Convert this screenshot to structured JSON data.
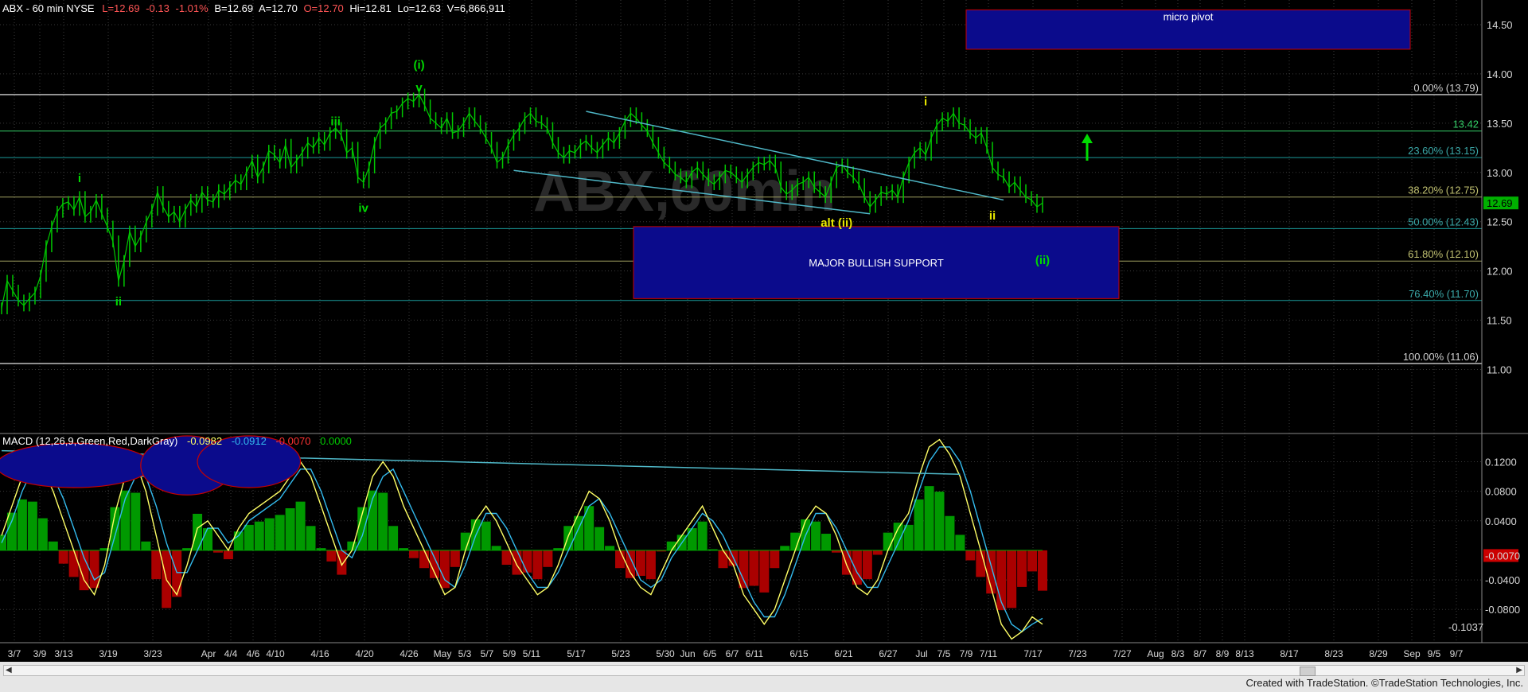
{
  "header": {
    "symbol": "ABX - 60 min  NYSE",
    "last": "L=12.69",
    "change": "-0.13",
    "change_pct": "-1.01%",
    "bid": "B=12.69",
    "ask": "A=12.70",
    "open": "O=12.70",
    "high": "Hi=12.81",
    "low": "Lo=12.63",
    "volume": "V=6,866,911"
  },
  "macd_header": {
    "name": "MACD (12,26,9,Green,Red,DarkGray)",
    "macd": "-0.0982",
    "signal": "-0.0912",
    "hist": "-0.0070",
    "zero": "0.0000"
  },
  "watermark": "ABX,60min",
  "footer_text": "Created with TradeStation. ©TradeStation Technologies, Inc.",
  "colors": {
    "price": "#00c800",
    "fib": "#1a9a9a",
    "wave_green": "#00d800",
    "wave_yellow": "#e6e600",
    "box": "#0b0b8c",
    "box_border": "#c80000",
    "macd_line": "#ffff66",
    "signal_line": "#33bbee",
    "hist_pos": "#009900",
    "hist_neg": "#aa0000"
  },
  "boxes": [
    {
      "label": "micro pivot",
      "x_start": "7/5",
      "x_end": "Sep 9/5",
      "y_low": 14.25,
      "y_high": 14.65
    },
    {
      "label": "MAJOR BULLISH SUPPORT",
      "x_start": "5/23",
      "x_end": "7/23",
      "y_low": 11.72,
      "y_high": 12.45
    }
  ],
  "wave_labels": [
    {
      "text": "(i)",
      "color": "green",
      "x_idx": 75,
      "y": 14.05
    },
    {
      "text": "v",
      "color": "green",
      "x_idx": 75,
      "y": 13.82
    },
    {
      "text": "iii",
      "color": "green",
      "x_idx": 60,
      "y": 13.48
    },
    {
      "text": "iv",
      "color": "green",
      "x_idx": 65,
      "y": 12.6
    },
    {
      "text": "i",
      "color": "green",
      "x_idx": 14,
      "y": 12.9
    },
    {
      "text": "ii",
      "color": "green",
      "x_idx": 21,
      "y": 11.65
    },
    {
      "text": "i",
      "color": "yellow",
      "x_idx": 166,
      "y": 13.68
    },
    {
      "text": "alt (ii)",
      "color": "yellow",
      "x_idx": 150,
      "y": 12.45
    },
    {
      "text": "ii",
      "color": "yellow",
      "x_idx": 178,
      "y": 12.52
    },
    {
      "text": "(ii)",
      "color": "green",
      "x_idx": 187,
      "y": 12.07
    }
  ],
  "chart_data": {
    "type": "line",
    "title": "ABX - 60 min  NYSE",
    "price_axis": {
      "ylim": [
        10.35,
        14.75
      ],
      "ticks": [
        "14.50",
        "14.00",
        "13.50",
        "13.00",
        "12.50",
        "12.00",
        "11.50",
        "11.00"
      ],
      "last_value": "12.69"
    },
    "macd_axis": {
      "ylim": [
        -0.125,
        0.155
      ],
      "ticks": [
        "0.1200",
        "0.0800",
        "0.0400",
        "-0.0400",
        "-0.0800"
      ],
      "current_hist": "-0.0070",
      "current_macd": "-0.1037"
    },
    "x_labels": [
      "3/7",
      "3/9",
      "3/13",
      "3/19",
      "3/23",
      "Apr",
      "4/4",
      "4/6",
      "4/10",
      "4/16",
      "4/20",
      "4/26",
      "May",
      "5/3",
      "5/7",
      "5/9",
      "5/11",
      "5/17",
      "5/23",
      "5/30",
      "Jun",
      "6/5",
      "6/7",
      "6/11",
      "6/15",
      "6/21",
      "6/27",
      "Jul",
      "7/5",
      "7/9",
      "7/11",
      "7/17",
      "7/23",
      "7/27",
      "Aug",
      "8/3",
      "8/7",
      "8/9",
      "8/13",
      "8/17",
      "8/23",
      "8/29",
      "Sep",
      "9/5",
      "9/7"
    ],
    "fib_levels": [
      {
        "label": "0.00% (13.79)",
        "value": 13.79
      },
      {
        "label": "13.42",
        "value": 13.42
      },
      {
        "label": "23.60% (13.15)",
        "value": 13.15
      },
      {
        "label": "38.20% (12.75)",
        "value": 12.75
      },
      {
        "label": "50.00% (12.43)",
        "value": 12.43
      },
      {
        "label": "61.80% (12.10)",
        "value": 12.1
      },
      {
        "label": "76.40% (11.70)",
        "value": 11.7
      },
      {
        "label": "100.00% (11.06)",
        "value": 11.06
      }
    ],
    "price_series": [
      11.62,
      11.9,
      11.8,
      11.7,
      11.65,
      11.72,
      11.78,
      11.95,
      12.25,
      12.45,
      12.6,
      12.68,
      12.7,
      12.62,
      12.75,
      12.55,
      12.6,
      12.72,
      12.58,
      12.45,
      12.3,
      11.9,
      12.1,
      12.4,
      12.25,
      12.35,
      12.5,
      12.62,
      12.8,
      12.65,
      12.55,
      12.6,
      12.5,
      12.62,
      12.72,
      12.65,
      12.8,
      12.72,
      12.7,
      12.82,
      12.78,
      12.85,
      12.92,
      12.88,
      13.0,
      13.12,
      12.95,
      13.05,
      13.22,
      13.18,
      13.1,
      13.28,
      13.05,
      13.12,
      13.2,
      13.3,
      13.25,
      13.35,
      13.28,
      13.4,
      13.45,
      13.38,
      13.2,
      13.25,
      12.95,
      12.9,
      13.05,
      13.3,
      13.45,
      13.5,
      13.6,
      13.62,
      13.7,
      13.75,
      13.72,
      13.79,
      13.68,
      13.55,
      13.5,
      13.45,
      13.55,
      13.4,
      13.42,
      13.5,
      13.6,
      13.52,
      13.45,
      13.35,
      13.25,
      13.1,
      13.15,
      13.28,
      13.38,
      13.45,
      13.55,
      13.6,
      13.52,
      13.5,
      13.45,
      13.3,
      13.2,
      13.15,
      13.22,
      13.2,
      13.28,
      13.32,
      13.25,
      13.2,
      13.28,
      13.35,
      13.3,
      13.4,
      13.52,
      13.6,
      13.55,
      13.48,
      13.42,
      13.3,
      13.2,
      13.1,
      13.05,
      12.98,
      12.95,
      12.9,
      13.0,
      13.05,
      12.98,
      12.92,
      12.88,
      12.95,
      13.02,
      13.0,
      12.95,
      12.9,
      12.98,
      13.05,
      13.1,
      13.08,
      13.12,
      13.05,
      12.85,
      12.78,
      12.82,
      12.88,
      12.9,
      12.95,
      12.85,
      12.8,
      12.75,
      12.9,
      13.05,
      13.08,
      13.0,
      12.95,
      12.88,
      12.75,
      12.65,
      12.72,
      12.8,
      12.78,
      12.82,
      12.75,
      12.95,
      13.1,
      13.2,
      13.25,
      13.18,
      13.35,
      13.48,
      13.55,
      13.52,
      13.6,
      13.5,
      13.48,
      13.4,
      13.35,
      13.4,
      13.25,
      13.05,
      12.98,
      12.95,
      12.85,
      12.9,
      12.82,
      12.75,
      12.72,
      12.65,
      12.69
    ],
    "trendlines": [
      {
        "from_idx": 105,
        "from_val": 13.62,
        "to_idx": 180,
        "to_val": 12.72
      },
      {
        "from_idx": 92,
        "from_val": 13.02,
        "to_idx": 156,
        "to_val": 12.58
      }
    ],
    "macd_series": [
      0.02,
      0.06,
      0.1,
      0.12,
      0.11,
      0.08,
      0.04,
      0.0,
      -0.04,
      -0.06,
      -0.02,
      0.05,
      0.1,
      0.12,
      0.08,
      0.02,
      -0.04,
      -0.06,
      -0.02,
      0.03,
      0.04,
      0.02,
      0.0,
      0.03,
      0.05,
      0.06,
      0.07,
      0.08,
      0.1,
      0.12,
      0.1,
      0.06,
      0.02,
      -0.02,
      0.0,
      0.05,
      0.1,
      0.12,
      0.1,
      0.06,
      0.03,
      0.0,
      -0.03,
      -0.06,
      -0.05,
      0.0,
      0.04,
      0.06,
      0.04,
      0.01,
      -0.02,
      -0.04,
      -0.06,
      -0.05,
      -0.02,
      0.02,
      0.05,
      0.08,
      0.07,
      0.04,
      0.0,
      -0.03,
      -0.05,
      -0.06,
      -0.03,
      0.0,
      0.02,
      0.04,
      0.06,
      0.03,
      0.0,
      -0.02,
      -0.06,
      -0.08,
      -0.1,
      -0.08,
      -0.04,
      0.0,
      0.04,
      0.06,
      0.05,
      0.02,
      -0.02,
      -0.05,
      -0.06,
      -0.04,
      0.0,
      0.03,
      0.05,
      0.1,
      0.14,
      0.15,
      0.13,
      0.1,
      0.05,
      0.0,
      -0.05,
      -0.1,
      -0.12,
      -0.11,
      -0.09,
      -0.1
    ],
    "signal_series": [
      0.01,
      0.04,
      0.08,
      0.11,
      0.115,
      0.1,
      0.07,
      0.03,
      -0.01,
      -0.04,
      -0.03,
      0.02,
      0.07,
      0.1,
      0.1,
      0.06,
      0.01,
      -0.03,
      -0.03,
      0.0,
      0.03,
      0.03,
      0.01,
      0.02,
      0.04,
      0.05,
      0.06,
      0.07,
      0.09,
      0.11,
      0.11,
      0.08,
      0.04,
      0.0,
      -0.01,
      0.02,
      0.07,
      0.1,
      0.11,
      0.08,
      0.05,
      0.02,
      -0.01,
      -0.04,
      -0.05,
      -0.02,
      0.02,
      0.05,
      0.05,
      0.03,
      0.0,
      -0.03,
      -0.05,
      -0.05,
      -0.03,
      0.0,
      0.03,
      0.06,
      0.07,
      0.05,
      0.02,
      -0.01,
      -0.04,
      -0.05,
      -0.04,
      -0.01,
      0.01,
      0.03,
      0.05,
      0.04,
      0.02,
      -0.01,
      -0.04,
      -0.07,
      -0.09,
      -0.09,
      -0.06,
      -0.02,
      0.02,
      0.05,
      0.05,
      0.03,
      0.0,
      -0.03,
      -0.05,
      -0.05,
      -0.02,
      0.01,
      0.04,
      0.08,
      0.12,
      0.14,
      0.14,
      0.12,
      0.08,
      0.03,
      -0.02,
      -0.07,
      -0.1,
      -0.11,
      -0.1,
      -0.092
    ],
    "macd_trendline": {
      "from_idx": 0,
      "from_val": 0.135,
      "to_idx": 93,
      "to_val": 0.103
    },
    "ellipses": [
      {
        "center_idx": 7,
        "center_val": 0.115,
        "w_idx": 7.5,
        "h_val": 0.03
      },
      {
        "center_idx": 18,
        "center_val": 0.115,
        "w_idx": 4.5,
        "h_val": 0.04
      },
      {
        "center_idx": 24,
        "center_val": 0.12,
        "w_idx": 5,
        "h_val": 0.035
      }
    ]
  }
}
